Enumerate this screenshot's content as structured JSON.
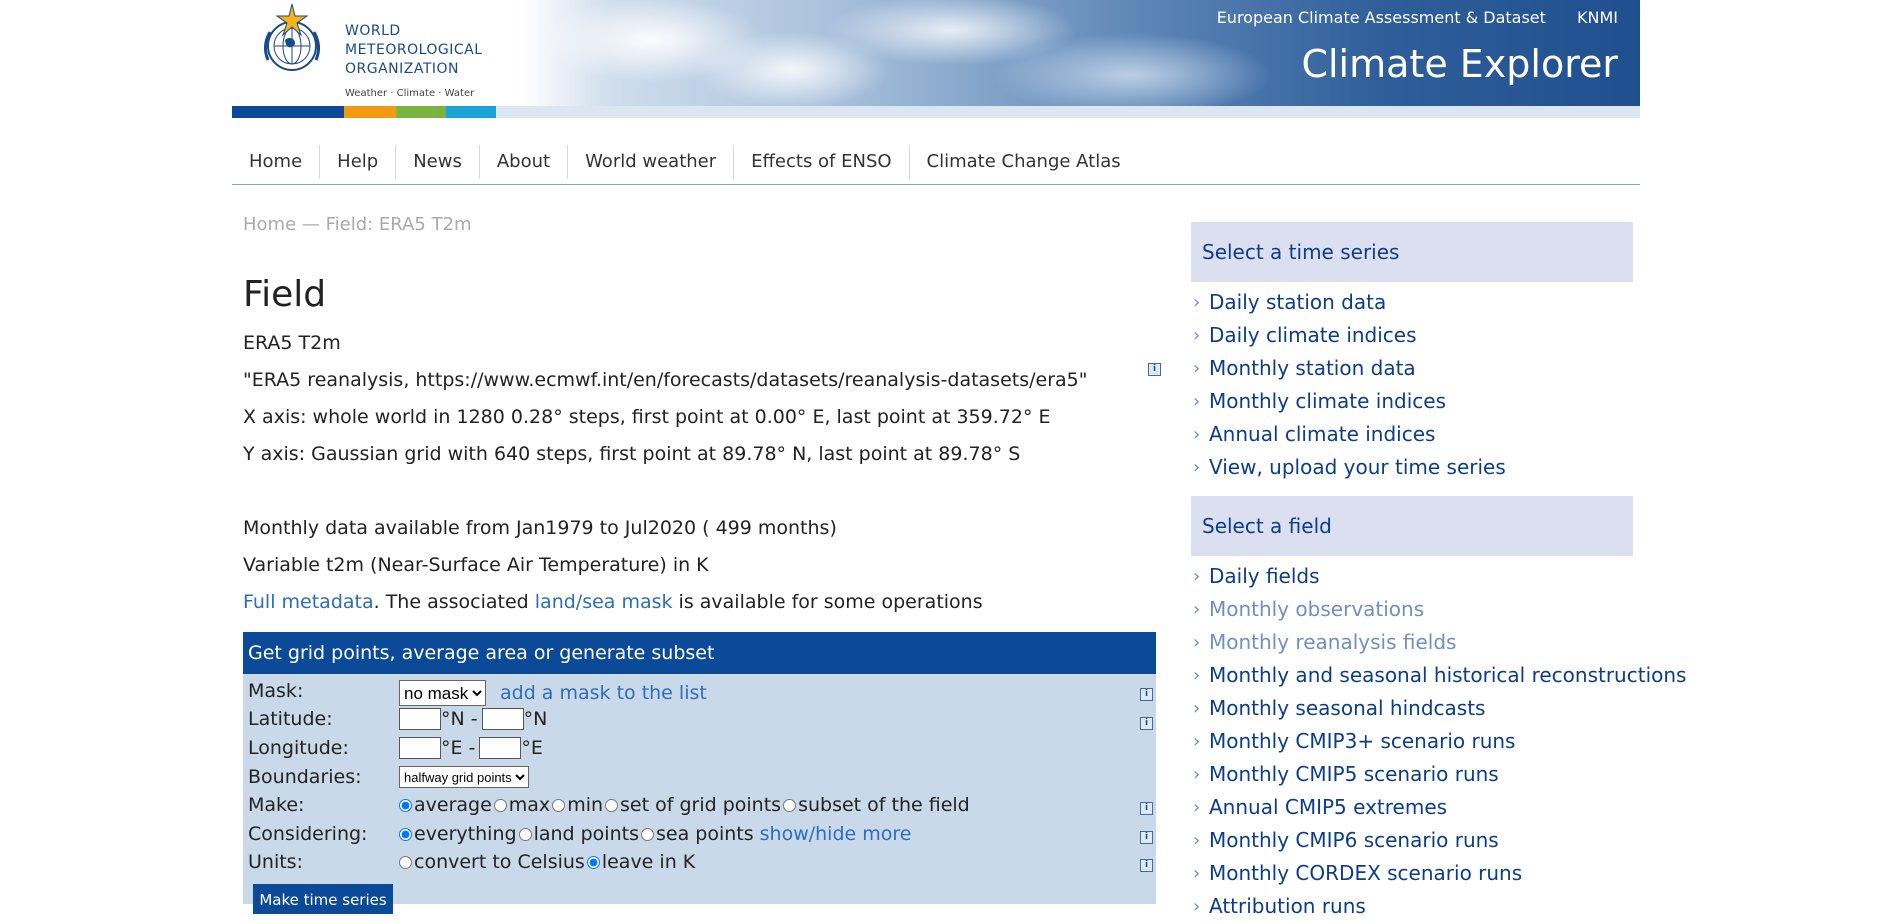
{
  "header": {
    "logo_text": [
      "WORLD",
      "METEOROLOGICAL",
      "ORGANIZATION"
    ],
    "logo_tagline": "Weather · Climate · Water",
    "links": [
      "European Climate Assessment & Dataset",
      "KNMI"
    ],
    "site_title": "Climate Explorer",
    "colorbar": [
      "#0b4a98",
      "#f29a11",
      "#7ab33e",
      "#19a3d6"
    ]
  },
  "nav": {
    "items": [
      "Home",
      "Help",
      "News",
      "About",
      "World weather",
      "Effects of ENSO",
      "Climate Change Atlas"
    ]
  },
  "breadcrumb": "Home — Field: ERA5 T2m",
  "page_title": "Field",
  "info": {
    "name": "ERA5 T2m",
    "source": "\"ERA5 reanalysis, https://www.ecmwf.int/en/forecasts/datasets/reanalysis-datasets/era5\"",
    "x_axis": "X axis: whole world in 1280 0.28° steps, first point at 0.00° E, last point at 359.72° E",
    "y_axis": "Y axis: Gaussian grid with 640 steps, first point at 89.78° N, last point at 89.78° S",
    "availability": "Monthly data available from Jan1979 to Jul2020 ( 499 months)",
    "variable": "Variable t2m (Near-Surface Air Temperature) in K",
    "metadata_link": "Full metadata",
    "metadata_mid": ". The associated ",
    "mask_link": "land/sea mask",
    "metadata_tail": " is available for some operations"
  },
  "form": {
    "title": "Get grid points, average area or generate subset",
    "mask_label": "Mask:",
    "mask_value": "no mask",
    "add_mask_link": "add a mask to the list",
    "latitude_label": "Latitude:",
    "lat_unit_1": "°N -",
    "lat_unit_2": "°N",
    "longitude_label": "Longitude:",
    "lon_unit_1": "°E -",
    "lon_unit_2": "°E",
    "boundaries_label": "Boundaries:",
    "boundaries_value": "halfway grid points",
    "make_label": "Make:",
    "make_options": [
      "average",
      "max",
      "min",
      "set of grid points",
      "subset of the field"
    ],
    "considering_label": "Considering:",
    "considering_options": [
      "everything",
      "land points",
      "sea points"
    ],
    "show_hide_link": "show/hide more",
    "units_label": "Units:",
    "units_options": [
      "convert to Celsius",
      "leave in K"
    ],
    "submit_label": "Make time series"
  },
  "sidebar": {
    "time_series_head": "Select a time series",
    "time_series_items": [
      "Daily station data",
      "Daily climate indices",
      "Monthly station data",
      "Monthly climate indices",
      "Annual climate indices",
      "View, upload your time series"
    ],
    "field_head": "Select a field",
    "field_items": [
      "Daily fields",
      "Monthly observations",
      "Monthly reanalysis fields",
      "Monthly and seasonal historical reconstructions",
      "Monthly seasonal hindcasts",
      "Monthly CMIP3+ scenario runs",
      "Monthly CMIP5 scenario runs",
      "Annual CMIP5 extremes",
      "Monthly CMIP6 scenario runs",
      "Monthly CORDEX scenario runs",
      "Attribution runs"
    ]
  },
  "icons": {
    "logo": "wmo-emblem-icon",
    "help": "info-icon",
    "list_marker": "chevron-right-icon"
  }
}
